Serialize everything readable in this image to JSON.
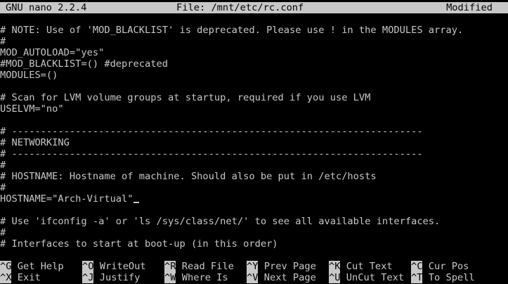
{
  "titlebar": {
    "app": "GNU nano 2.2.4",
    "file": "File: /mnt/etc/rc.conf",
    "status": "Modified"
  },
  "editor": {
    "lines": [
      "",
      "# NOTE: Use of 'MOD_BLACKLIST' is deprecated. Please use ! in the MODULES array.",
      "#",
      "MOD_AUTOLOAD=\"yes\"",
      "#MOD_BLACKLIST=() #deprecated",
      "MODULES=()",
      "",
      "# Scan for LVM volume groups at startup, required if you use LVM",
      "USELVM=\"no\"",
      "",
      "# -----------------------------------------------------------------------",
      "# NETWORKING",
      "# -----------------------------------------------------------------------",
      "#",
      "# HOSTNAME: Hostname of machine. Should also be put in /etc/hosts",
      "#",
      "HOSTNAME=\"Arch-Virtual\"",
      "",
      "# Use 'ifconfig -a' or 'ls /sys/class/net/' to see all available interfaces.",
      "#",
      "# Interfaces to start at boot-up (in this order)"
    ]
  },
  "shortcuts": {
    "row1": [
      {
        "key": "^G",
        "label": "Get Help"
      },
      {
        "key": "^O",
        "label": "WriteOut"
      },
      {
        "key": "^R",
        "label": "Read File"
      },
      {
        "key": "^Y",
        "label": "Prev Page"
      },
      {
        "key": "^K",
        "label": "Cut Text"
      },
      {
        "key": "^C",
        "label": "Cur Pos"
      }
    ],
    "row2": [
      {
        "key": "^X",
        "label": "Exit"
      },
      {
        "key": "^J",
        "label": "Justify"
      },
      {
        "key": "^W",
        "label": "Where Is"
      },
      {
        "key": "^V",
        "label": "Next Page"
      },
      {
        "key": "^U",
        "label": "UnCut Text"
      },
      {
        "key": "^T",
        "label": "To Spell"
      }
    ]
  },
  "colors": {
    "background": "#000000",
    "foreground": "#c8c8c8",
    "inverse_bg": "#c8c8c8",
    "inverse_fg": "#000000"
  }
}
